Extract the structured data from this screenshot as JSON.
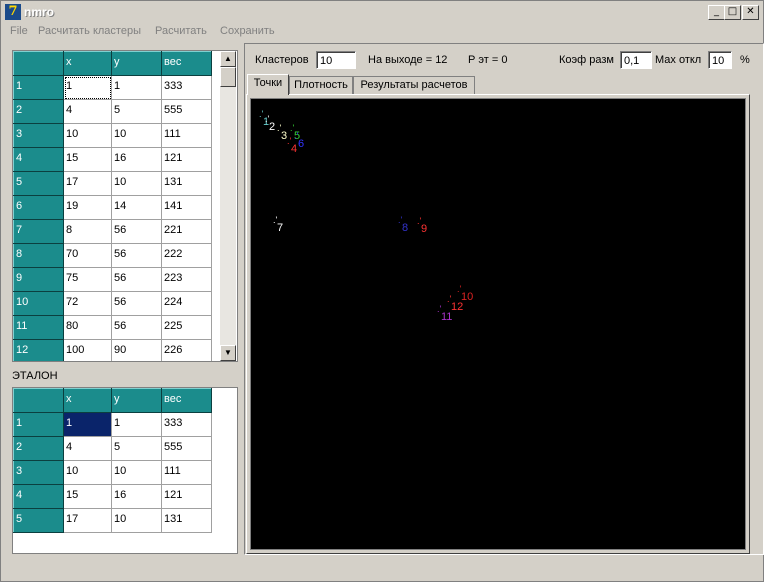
{
  "window": {
    "title": "nmro",
    "icon_glyph": "7"
  },
  "menu": [
    "File",
    "Расчитать кластеры",
    "Расчитать",
    "Сохранить"
  ],
  "grid1": {
    "headers": [
      "",
      "x",
      "y",
      "вес"
    ],
    "rows": [
      [
        "1",
        "1",
        "1",
        "333"
      ],
      [
        "2",
        "4",
        "5",
        "555"
      ],
      [
        "3",
        "10",
        "10",
        "111"
      ],
      [
        "4",
        "15",
        "16",
        "121"
      ],
      [
        "5",
        "17",
        "10",
        "131"
      ],
      [
        "6",
        "19",
        "14",
        "141"
      ],
      [
        "7",
        "8",
        "56",
        "221"
      ],
      [
        "8",
        "70",
        "56",
        "222"
      ],
      [
        "9",
        "75",
        "56",
        "223"
      ],
      [
        "10",
        "72",
        "56",
        "224"
      ],
      [
        "11",
        "80",
        "56",
        "225"
      ],
      [
        "12",
        "100",
        "90",
        "226"
      ]
    ]
  },
  "etalon_label": "ЭТАЛОН",
  "grid2": {
    "headers": [
      "",
      "x",
      "y",
      "вес"
    ],
    "rows": [
      [
        "1",
        "1",
        "1",
        "333"
      ],
      [
        "2",
        "4",
        "5",
        "555"
      ],
      [
        "3",
        "10",
        "10",
        "111"
      ],
      [
        "4",
        "15",
        "16",
        "121"
      ],
      [
        "5",
        "17",
        "10",
        "131"
      ]
    ]
  },
  "controls": {
    "clusters_label": "Кластеров",
    "clusters_value": "10",
    "output_label": "На выходе = 12",
    "ret_label": "Р эт = 0",
    "coef_label": "Коэф разм",
    "coef_value": "0,1",
    "max_label": "Мах откл",
    "max_value": "10",
    "percent": "%"
  },
  "tabs": [
    "Точки",
    "Плотность",
    "Результаты расчетов"
  ],
  "points": [
    {
      "label": "1",
      "color": "#66cccc"
    },
    {
      "label": "2",
      "color": "#ffffff"
    },
    {
      "label": "3",
      "color": "#ffffcc"
    },
    {
      "label": "4",
      "color": "#ff3333"
    },
    {
      "label": "5",
      "color": "#33cc33"
    },
    {
      "label": "6",
      "color": "#3333ff"
    },
    {
      "label": "7",
      "color": "#ffffff"
    },
    {
      "label": "8",
      "color": "#3333cc"
    },
    {
      "label": "9",
      "color": "#ff3333"
    },
    {
      "label": "10",
      "color": "#dd2222"
    },
    {
      "label": "11",
      "color": "#aa33cc"
    },
    {
      "label": "12",
      "color": "#ff3333"
    }
  ]
}
